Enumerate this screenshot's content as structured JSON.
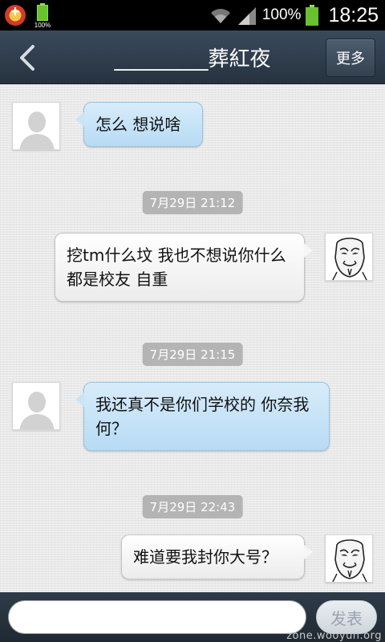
{
  "status_bar": {
    "mini_battery_percent": "100%",
    "battery_percent": "100%",
    "time": "18:25"
  },
  "header": {
    "title": "_________葬紅夜",
    "more_label": "更多"
  },
  "messages": [
    {
      "type": "incoming",
      "text": "怎么  想说啥"
    },
    {
      "type": "timestamp",
      "text": "7月29日 21:12"
    },
    {
      "type": "outgoing",
      "text": "挖tm什么坟 我也不想说你什么  都是校友 自重"
    },
    {
      "type": "timestamp",
      "text": "7月29日 21:15"
    },
    {
      "type": "incoming",
      "text": "我还真不是你们学校的  你奈我何？"
    },
    {
      "type": "timestamp",
      "text": "7月29日 22:43"
    },
    {
      "type": "outgoing",
      "text": "难道要我封你大号？"
    }
  ],
  "input": {
    "value": "",
    "send_label": "发表"
  },
  "watermark": "zone.wooyun.org",
  "colors": {
    "title_bar": "#2e3b4a",
    "incoming_bubble": "#c2e0f6",
    "outgoing_bubble": "#f4f4f4",
    "timestamp_bg": "#b4b4b4"
  }
}
